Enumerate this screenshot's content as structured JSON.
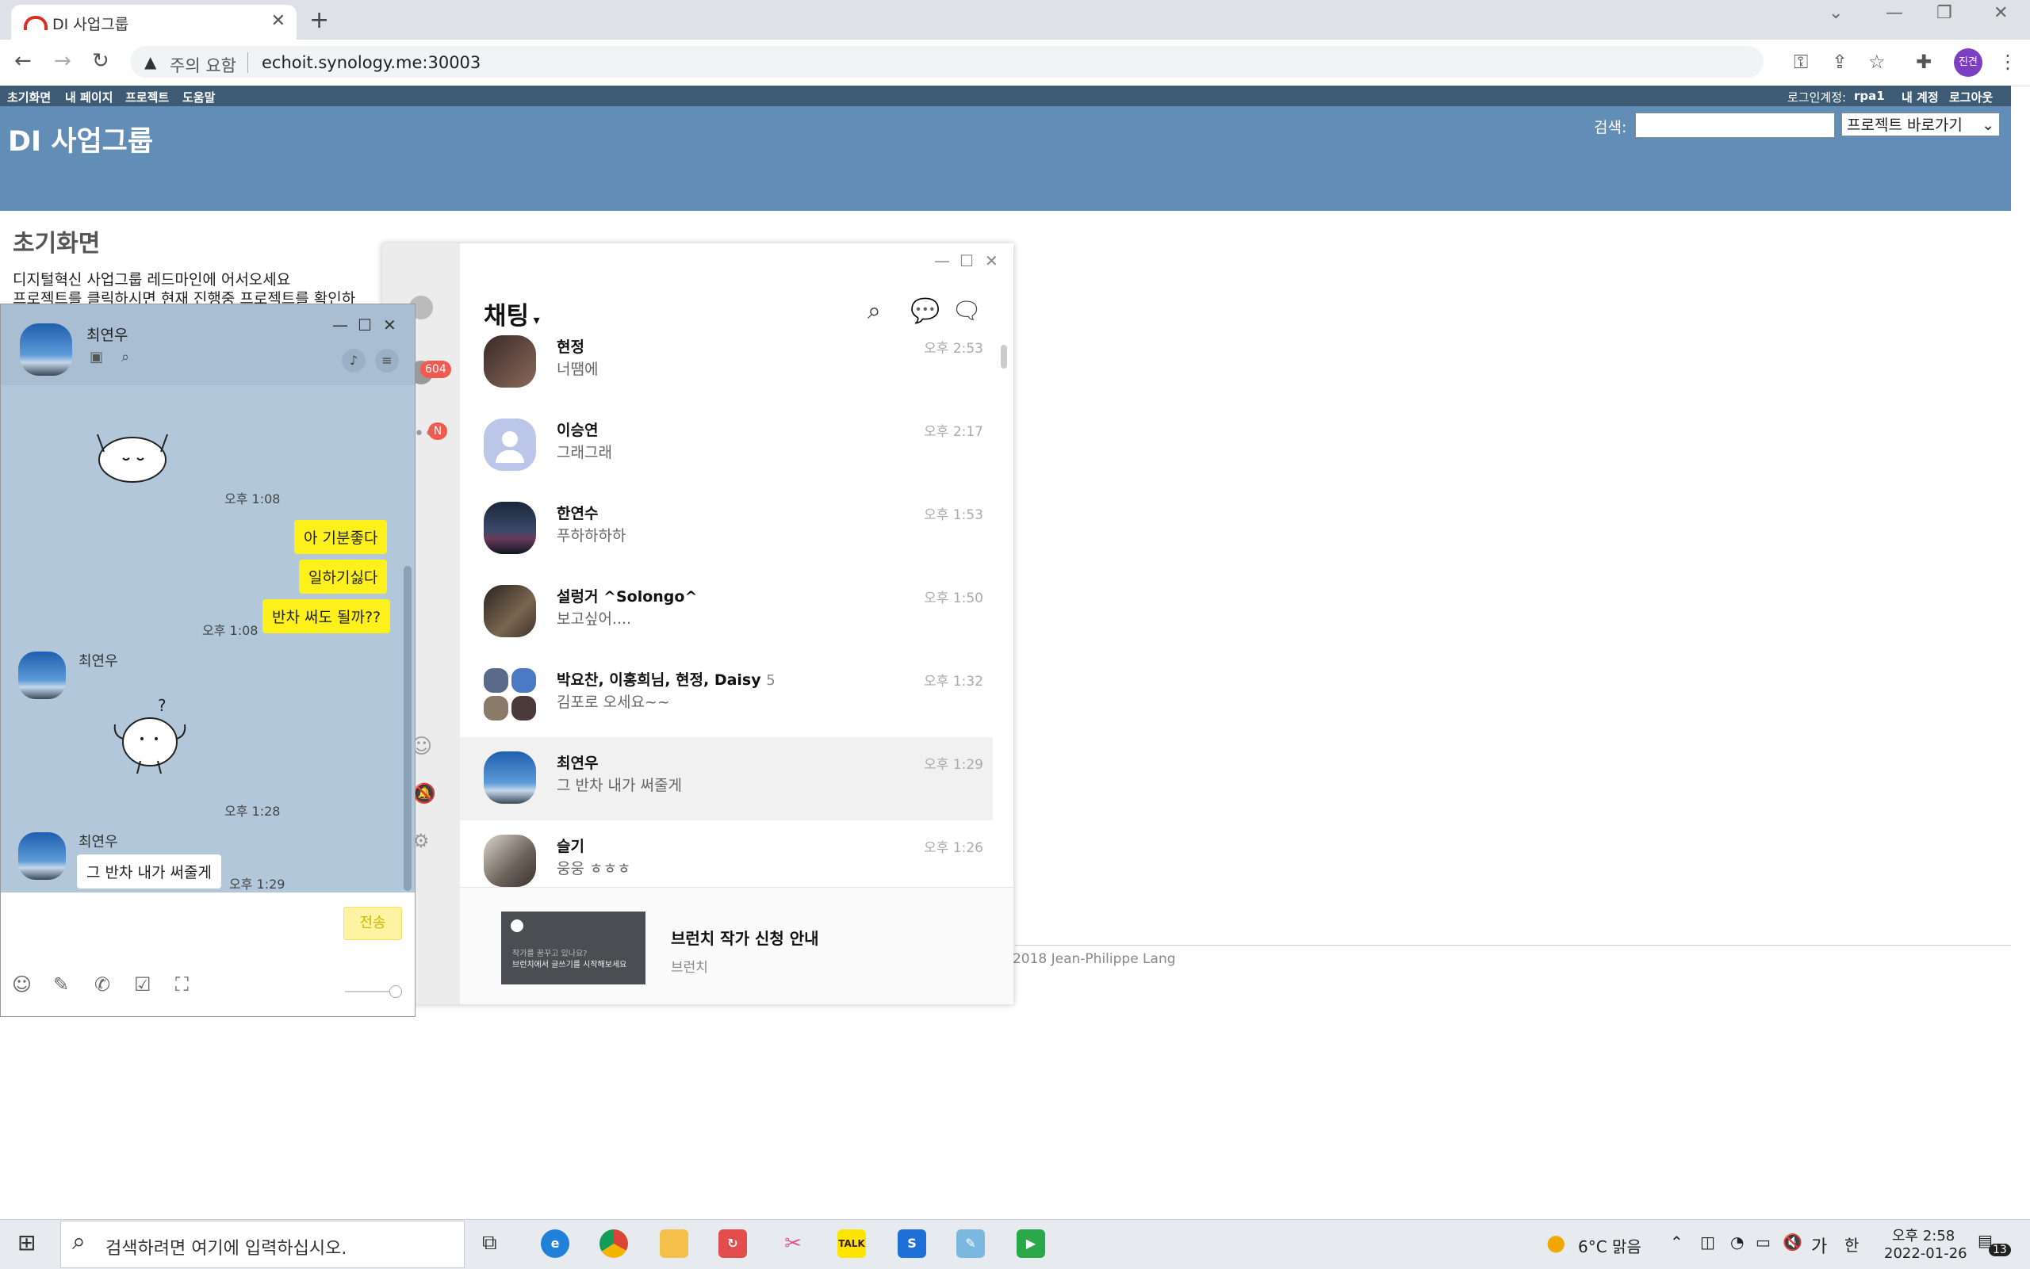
{
  "browser": {
    "tab_title": "DI 사업그룹",
    "new_tab": "+",
    "warning": "주의 요함",
    "url": "echoit.synology.me:30003",
    "profile_initials": "진견"
  },
  "redmine": {
    "top_menu": [
      "초기화면",
      "내 페이지",
      "프로젝트",
      "도움말"
    ],
    "logged_in_label": "로그인계정:",
    "logged_in_user": "rpa1",
    "my_account": "내 계정",
    "logout": "로그아웃",
    "site_title": "DI 사업그룹",
    "search_label": "검색:",
    "jump_label": "프로젝트 바로가기",
    "page_title": "초기화면",
    "welcome_line1": "디지털혁신 사업그룹 레드마인에 어서오세요",
    "welcome_line2": "프로젝트를 클릭하시면 현재 진행중 프로젝트를 확인하",
    "footer": "5-2018 Jean-Philippe Lang"
  },
  "kakao": {
    "title": "채팅",
    "badge_chats": "604",
    "badge_more": "N",
    "chats": [
      {
        "name": "현정",
        "msg": "너땜에",
        "time": "오후 2:53"
      },
      {
        "name": "이승연",
        "msg": "그래그래",
        "time": "오후 2:17"
      },
      {
        "name": "한연수",
        "msg": "푸하하하하",
        "time": "오후 1:53"
      },
      {
        "name": "설렁거 ^Solongo^",
        "msg": "보고싶어....",
        "time": "오후 1:50"
      },
      {
        "name": "박요찬, 이홍희님, 현정, Daisy",
        "count": "5",
        "msg": "김포로 오세요~~",
        "time": "오후 1:32"
      },
      {
        "name": "최연우",
        "msg": "그 반차 내가 써줄게",
        "time": "오후 1:29"
      },
      {
        "name": "슬기",
        "msg": "웅웅 ㅎㅎㅎ",
        "time": "오후 1:26"
      }
    ],
    "banner": {
      "title": "브런치 작가 신청 안내",
      "sub": "브런치",
      "img_line1": "작가를 꿈꾸고 있나요?",
      "img_line2": "브런치에서 글쓰기를 시작해보세요"
    }
  },
  "chatroom": {
    "partner": "최연우",
    "time1": "오후 1:08",
    "mine": [
      "아 기분좋다",
      "일하기싫다",
      "반차 써도 될까??"
    ],
    "time2": "오후 1:08",
    "sender": "최연우",
    "question": "?",
    "time3": "오후 1:28",
    "sender2": "최연우",
    "last_msg": "그 반차 내가 써줄게",
    "time4": "오후 1:29",
    "send": "전송"
  },
  "taskbar": {
    "search_placeholder": "검색하려면 여기에 입력하십시오.",
    "kakao_label": "TALK",
    "weather": "6°C 맑음",
    "ime": "가",
    "ime2": "한",
    "time": "오후 2:58",
    "date": "2022-01-26",
    "notifications": "13"
  }
}
